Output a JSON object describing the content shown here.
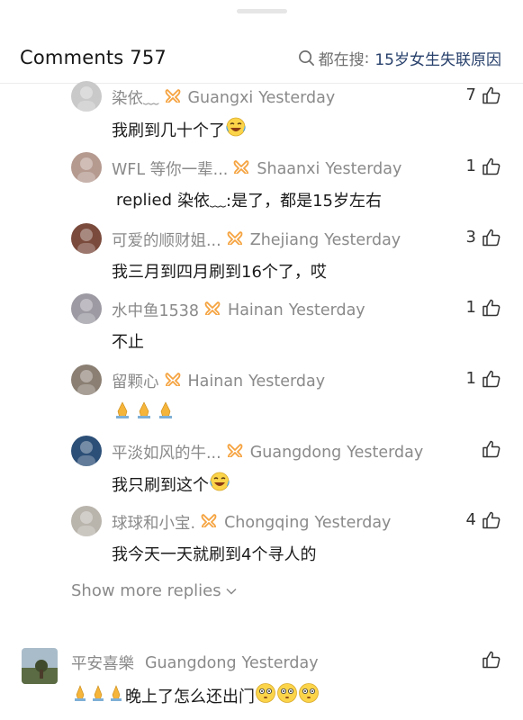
{
  "header": {
    "title": "Comments 757",
    "search_prefix": "都在搜",
    "search_colon": ":",
    "search_query": "15岁女生失联原因",
    "search_icon": "search-icon"
  },
  "comments": [
    {
      "user": "染依﹏",
      "location": "Guangxi",
      "time": "Yesterday",
      "likes": "7",
      "text": "我刷到几十个了",
      "emoji": "laughing-crying",
      "avatar_color": "#c9c9c9"
    },
    {
      "user": "WFL 等你一辈...",
      "location": "Shaanxi",
      "time": "Yesterday",
      "likes": "1",
      "reply_prefix": "replied",
      "reply_to": "染依﹏",
      "text": ":是了，都是15岁左右",
      "avatar_color": "#b59a90"
    },
    {
      "user": "可爱的顺财姐...",
      "location": "Zhejiang",
      "time": "Yesterday",
      "likes": "3",
      "text": "我三月到四月刷到16个了，哎",
      "avatar_color": "#7a4a3c"
    },
    {
      "user": "水中鱼1538",
      "location": "Hainan",
      "time": "Yesterday",
      "likes": "1",
      "text": "不止",
      "avatar_color": "#9d9aa3"
    },
    {
      "user": "留颗心",
      "location": "Hainan",
      "time": "Yesterday",
      "likes": "1",
      "text": "",
      "emoji": "folded-hands-x3",
      "avatar_color": "#8b7f73"
    },
    {
      "user": "平淡如风的牛...",
      "location": "Guangdong",
      "time": "Yesterday",
      "likes": "",
      "text": "我只刷到这个",
      "emoji": "laughing-crying",
      "avatar_color": "#2c4f77"
    },
    {
      "user": "球球和小宝.",
      "location": "Chongqing",
      "time": "Yesterday",
      "likes": "4",
      "text": "我今天一天就刷到4个寻人的",
      "avatar_color": "#b9b4ac"
    }
  ],
  "show_more": "Show more replies",
  "top_comment": {
    "user": "平安喜樂",
    "location": "Guangdong",
    "time": "Yesterday",
    "likes": "",
    "text": "晚上了怎么还出门",
    "avatar_color": "#6f7d5a"
  },
  "colors": {
    "badge_orange": "#f5a340",
    "link_blue": "#27406b",
    "meta_gray": "#8a8a8a"
  }
}
